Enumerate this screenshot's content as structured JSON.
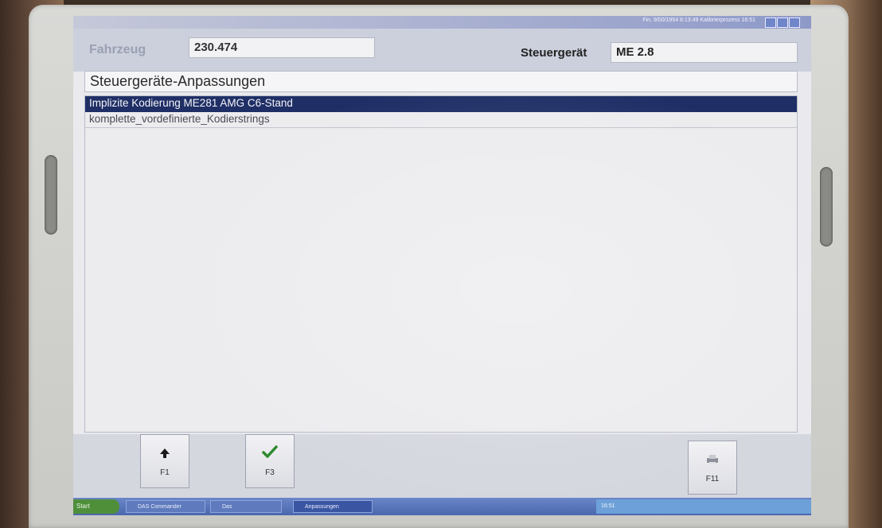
{
  "window": {
    "title_text": "Fin. 9/00/1954 8:13:49  Kalibrierprozess 16:51"
  },
  "header": {
    "vehicle_label": "Fahrzeug",
    "vehicle_value": "230.474",
    "ecu_label": "Steuergerät",
    "ecu_value": "ME 2.8"
  },
  "section": {
    "title": "Steuergeräte-Anpassungen"
  },
  "list": {
    "items": [
      {
        "label": "Implizite Kodierung ME281 AMG C6-Stand",
        "selected": true
      },
      {
        "label": "komplette_vordefinierte_Kodierstrings",
        "selected": false
      }
    ]
  },
  "function_keys": [
    {
      "label": "F1",
      "icon": "arrow-up-icon"
    },
    {
      "label": "F3",
      "icon": "checkmark-icon"
    },
    {
      "label": "F11",
      "icon": "printer-icon"
    }
  ],
  "taskbar": {
    "start_label": "Start",
    "buttons": [
      "DAS Commander",
      "Das",
      "Anpassungen"
    ],
    "tray_text": "16:51"
  },
  "colors": {
    "selection_bg": "#1f2f66",
    "check_green": "#2e8a2e",
    "header_bg": "#ccd0dc"
  }
}
